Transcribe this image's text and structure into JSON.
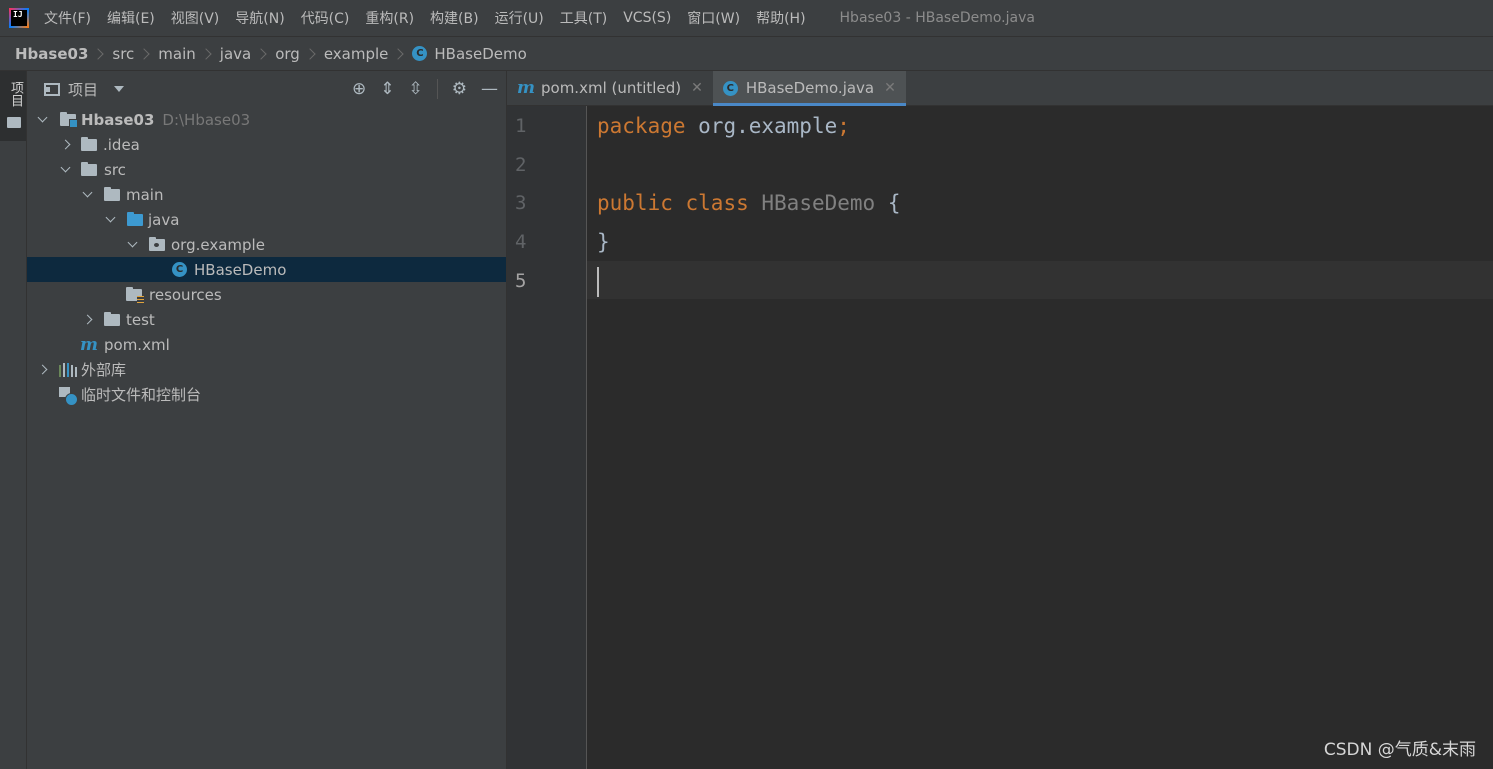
{
  "menubar": {
    "items": [
      "文件(F)",
      "编辑(E)",
      "视图(V)",
      "导航(N)",
      "代码(C)",
      "重构(R)",
      "构建(B)",
      "运行(U)",
      "工具(T)",
      "VCS(S)",
      "窗口(W)",
      "帮助(H)"
    ],
    "window_title": "Hbase03 - HBaseDemo.java",
    "logo_text": "IJ"
  },
  "breadcrumb": {
    "items": [
      "Hbase03",
      "src",
      "main",
      "java",
      "org",
      "example",
      "HBaseDemo"
    ]
  },
  "left_strip": {
    "label": "项目"
  },
  "project_panel": {
    "title": "项目",
    "tree": {
      "root": {
        "name": "Hbase03",
        "path": "D:\\Hbase03"
      },
      "idea": ".idea",
      "src": "src",
      "main": "main",
      "java": "java",
      "package": "org.example",
      "class_file": "HBaseDemo",
      "resources": "resources",
      "test": "test",
      "pom": "pom.xml",
      "external_libs": "外部库",
      "scratches": "临时文件和控制台"
    }
  },
  "editor": {
    "tabs": [
      {
        "label": "pom.xml (untitled)",
        "icon": "m"
      },
      {
        "label": "HBaseDemo.java",
        "icon": "C"
      }
    ],
    "line_numbers": [
      "1",
      "2",
      "3",
      "4",
      "5"
    ],
    "code": {
      "line1_kw": "package",
      "line1_rest": " org.example",
      "line1_semi": ";",
      "line3_kw1": "public",
      "line3_kw2": "class",
      "line3_cls": "HBaseDemo",
      "line3_brace": "{",
      "line4": "}"
    }
  },
  "watermark": "CSDN @气质&末雨",
  "colors": {
    "accent": "#4a88c7",
    "keyword": "#cc7832",
    "class_icon": "#3592c4",
    "selection": "#0d293e"
  }
}
